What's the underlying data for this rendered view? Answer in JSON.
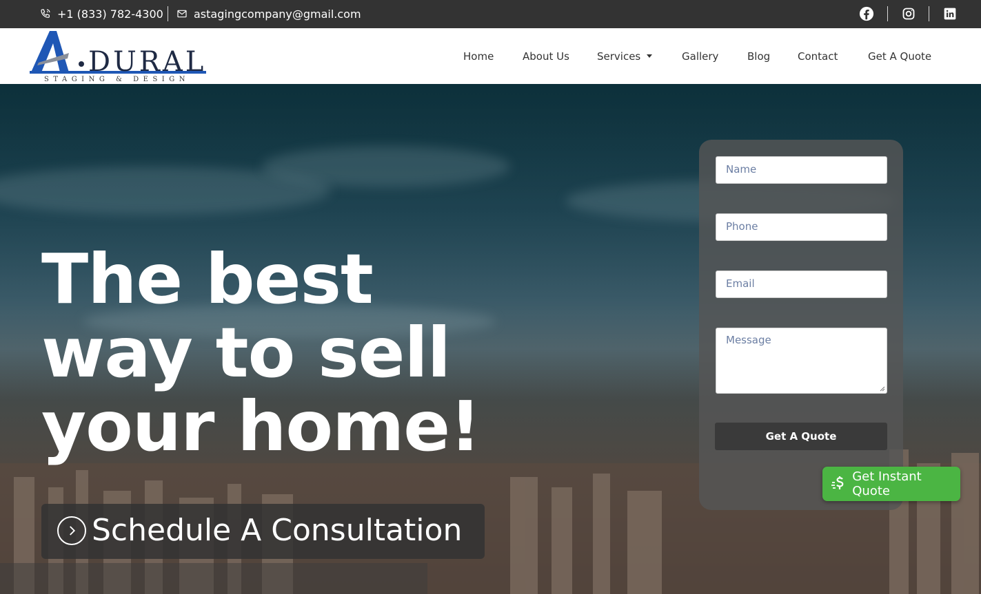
{
  "topbar": {
    "phone": "+1 (833) 782-4300",
    "email": "astagingcompany@gmail.com",
    "social": [
      "facebook-icon",
      "instagram-icon",
      "linkedin-icon"
    ]
  },
  "logo": {
    "letter": "A",
    "name": "DURAL",
    "tagline": "STAGING & DESIGN",
    "colors": {
      "blue": "#1f57b5",
      "dark": "#1f2a44",
      "gray": "#8a8f99"
    }
  },
  "nav": {
    "home": "Home",
    "about": "About Us",
    "services": "Services",
    "gallery": "Gallery",
    "blog": "Blog",
    "contact": "Contact",
    "quote": "Get A Quote"
  },
  "hero": {
    "headline": "The best\nway to sell\nyour home!",
    "cta": "Schedule A Consultation"
  },
  "form": {
    "name_placeholder": "Name",
    "phone_placeholder": "Phone",
    "email_placeholder": "Email",
    "message_placeholder": "Message",
    "submit": "Get A Quote"
  },
  "widget": {
    "label": "Get Instant Quote",
    "color": "#4bb543"
  },
  "colors": {
    "topbar": "#333333",
    "header": "#ffffff",
    "panel": "#555555"
  }
}
